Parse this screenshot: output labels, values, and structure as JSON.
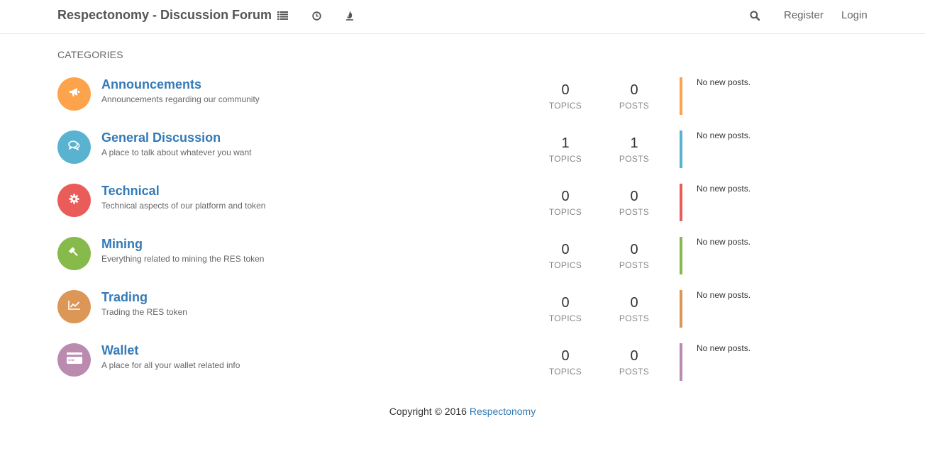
{
  "header": {
    "brand": "Respectonomy - Discussion Forum",
    "nav_icons": [
      "list-icon",
      "clock-icon",
      "fire-icon"
    ],
    "search_icon": "search-icon",
    "register_label": "Register",
    "login_label": "Login"
  },
  "main": {
    "section_title": "CATEGORIES",
    "topics_label": "TOPICS",
    "posts_label": "POSTS",
    "categories": [
      {
        "title": "Announcements",
        "description": "Announcements regarding our community",
        "topics": "0",
        "posts": "0",
        "teaser": "No new posts.",
        "color": "#fda34b",
        "icon": "bullhorn-icon"
      },
      {
        "title": "General Discussion",
        "description": "A place to talk about whatever you want",
        "topics": "1",
        "posts": "1",
        "teaser": "No new posts.",
        "color": "#59b3d0",
        "icon": "comments-icon"
      },
      {
        "title": "Technical",
        "description": "Technical aspects of our platform and token",
        "topics": "0",
        "posts": "0",
        "teaser": "No new posts.",
        "color": "#e95c5a",
        "icon": "cog-icon"
      },
      {
        "title": "Mining",
        "description": "Everything related to mining the RES token",
        "topics": "0",
        "posts": "0",
        "teaser": "No new posts.",
        "color": "#86ba4b",
        "icon": "gavel-icon"
      },
      {
        "title": "Trading",
        "description": "Trading the RES token",
        "topics": "0",
        "posts": "0",
        "teaser": "No new posts.",
        "color": "#dc9656",
        "icon": "line-chart-icon"
      },
      {
        "title": "Wallet",
        "description": "A place for all your wallet related info",
        "topics": "0",
        "posts": "0",
        "teaser": "No new posts.",
        "color": "#ba8baf",
        "icon": "credit-card-icon"
      }
    ]
  },
  "footer": {
    "copyright": "Copyright © 2016 ",
    "link": "Respectonomy"
  }
}
